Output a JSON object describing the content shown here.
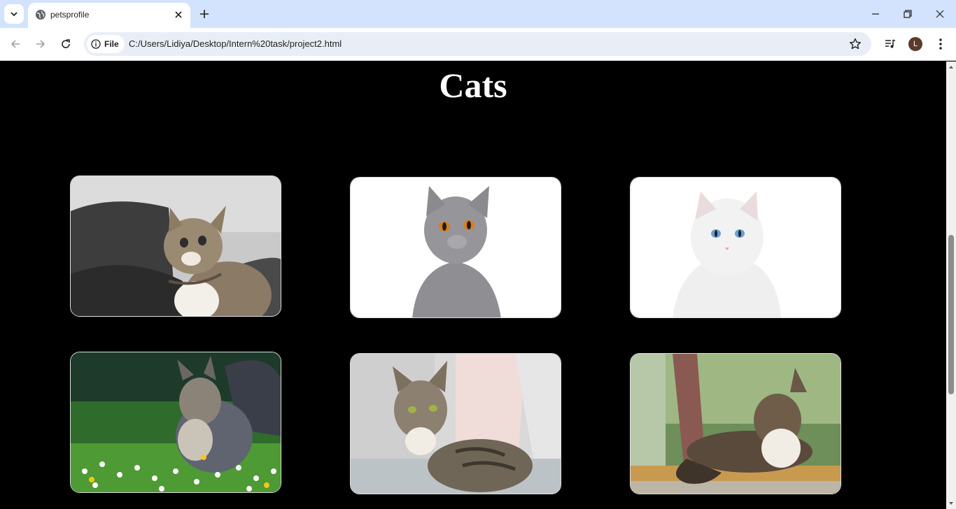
{
  "browser": {
    "tab_title": "petsprofile",
    "chip_label": "File",
    "url": "C:/Users/Lidiya/Desktop/Intern%20task/project2.html",
    "avatar_initial": "L"
  },
  "page": {
    "heading": "Cats",
    "cards": [
      {
        "image": "tabby-kitten-on-sofa-photo"
      },
      {
        "image": "grey-british-shorthair-photo"
      },
      {
        "image": "white-cat-blue-eyes-photo"
      },
      {
        "image": "maine-coon-in-flowers-photo"
      },
      {
        "image": "tabby-cat-on-couch-photo"
      },
      {
        "image": "tabby-cat-on-railing-photo"
      }
    ]
  },
  "colors": {
    "page_background": "#000000",
    "tabstrip": "#d3e3fd",
    "omnibox": "#e9eef6"
  }
}
